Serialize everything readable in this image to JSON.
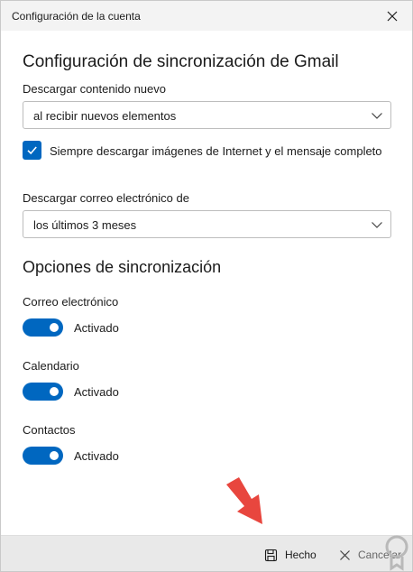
{
  "window": {
    "title": "Configuración de la cuenta"
  },
  "gmail_sync": {
    "heading": "Configuración de sincronización de Gmail",
    "download_content_label": "Descargar contenido nuevo",
    "download_content_value": "al recibir nuevos elementos",
    "always_download_images_label": "Siempre descargar imágenes de Internet y el mensaje completo",
    "always_download_images_checked": true,
    "download_email_from_label": "Descargar correo electrónico de",
    "download_email_from_value": "los últimos 3 meses"
  },
  "sync_options": {
    "heading": "Opciones de sincronización",
    "items": [
      {
        "label": "Correo electrónico",
        "state_text": "Activado",
        "on": true
      },
      {
        "label": "Calendario",
        "state_text": "Activado",
        "on": true
      },
      {
        "label": "Contactos",
        "state_text": "Activado",
        "on": true
      }
    ]
  },
  "footer": {
    "done_label": "Hecho",
    "cancel_label": "Cancelar"
  },
  "colors": {
    "accent": "#0067c0",
    "annotation_arrow": "#e8463e"
  },
  "icons": {
    "close": "close-icon",
    "dropdown": "chevron-down-icon",
    "check": "check-icon",
    "save": "save-icon",
    "cancel": "close-icon",
    "arrow": "red-arrow-annotation",
    "watermark": "logo-watermark"
  }
}
